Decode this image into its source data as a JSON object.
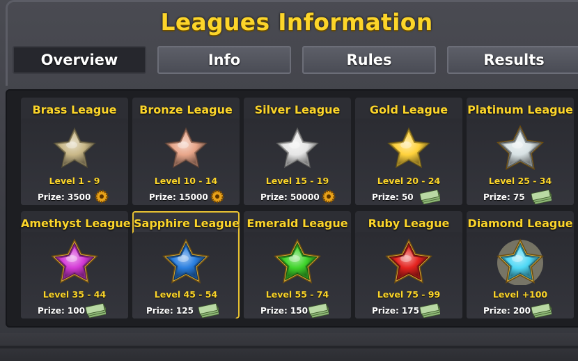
{
  "header": {
    "title": "Leagues Information"
  },
  "tabs": [
    {
      "label": "Overview",
      "active": true
    },
    {
      "label": "Info",
      "active": false
    },
    {
      "label": "Rules",
      "active": false
    },
    {
      "label": "Results",
      "active": false
    }
  ],
  "leagues": [
    {
      "name": "Brass League",
      "level": "Level 1 - 9",
      "prize": "Prize: 3500",
      "reward_icon": "gear-coin-icon",
      "star_color": "#c9b888"
    },
    {
      "name": "Bronze League",
      "level": "Level 10 - 14",
      "prize": "Prize: 15000",
      "reward_icon": "gear-coin-icon",
      "star_color": "#e8a68a"
    },
    {
      "name": "Silver League",
      "level": "Level 15 - 19",
      "prize": "Prize: 50000",
      "reward_icon": "gear-coin-icon",
      "star_color": "#e6e6e6"
    },
    {
      "name": "Gold League",
      "level": "Level 20 - 24",
      "prize": "Prize: 50",
      "reward_icon": "cash-stack-icon",
      "star_color": "#ffd23c"
    },
    {
      "name": "Platinum League",
      "level": "Level 25 - 34",
      "prize": "Prize: 75",
      "reward_icon": "cash-stack-icon",
      "star_color": "#d8e2e4"
    },
    {
      "name": "Amethyst League",
      "level": "Level 35 - 44",
      "prize": "Prize: 100",
      "reward_icon": "cash-stack-icon",
      "star_color": "#d43ad6"
    },
    {
      "name": "Sapphire League",
      "level": "Level 45 - 54",
      "prize": "Prize: 125",
      "reward_icon": "cash-stack-icon",
      "star_color": "#2a7fe0",
      "selected": true
    },
    {
      "name": "Emerald League",
      "level": "Level 55 - 74",
      "prize": "Prize: 150",
      "reward_icon": "cash-stack-icon",
      "star_color": "#3fd42b"
    },
    {
      "name": "Ruby League",
      "level": "Level 75 - 99",
      "prize": "Prize: 175",
      "reward_icon": "cash-stack-icon",
      "star_color": "#e4231f"
    },
    {
      "name": "Diamond League",
      "level": "Level +100",
      "prize": "Prize: 200",
      "reward_icon": "cash-stack-icon",
      "star_color": "#4fd8f6"
    }
  ],
  "colors": {
    "accent": "#fcd52a",
    "panel": "#1d1e22",
    "card": "#2d2e34",
    "selected_border": "#e8c132"
  }
}
